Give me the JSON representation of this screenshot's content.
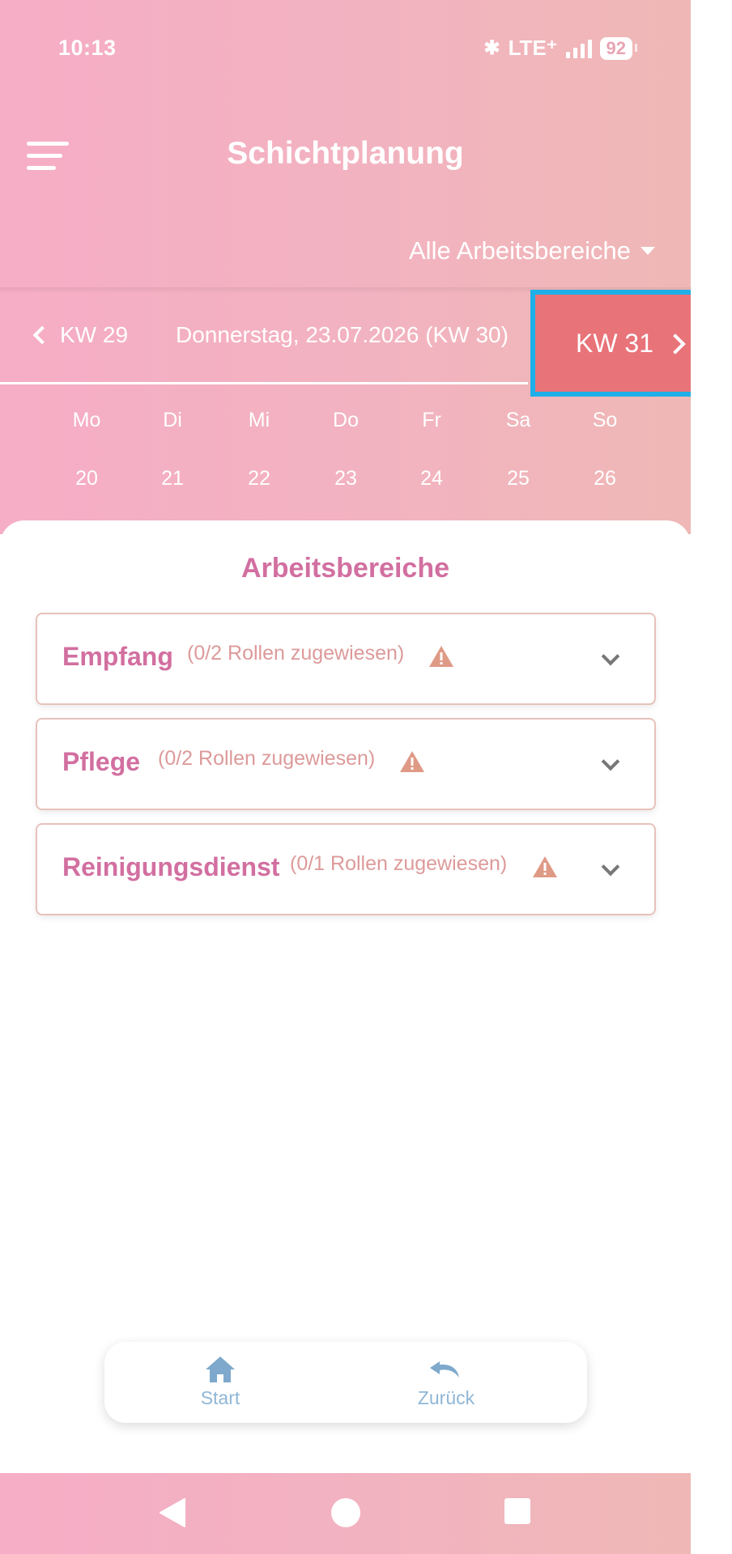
{
  "status_bar": {
    "time": "10:13",
    "bluetooth_icon": "bluetooth-icon",
    "network": "LTE⁺",
    "battery": "92"
  },
  "header": {
    "menu_icon": "hamburger-menu-icon",
    "title": "Schichtplanung",
    "area_filter": "Alle Arbeitsbereiche"
  },
  "week_nav": {
    "prev_label": "KW 29",
    "current_date": "Donnerstag, 23.07.2026 (KW 30)",
    "next_label": "KW 31"
  },
  "days": [
    {
      "name": "Mo",
      "date": "20"
    },
    {
      "name": "Di",
      "date": "21"
    },
    {
      "name": "Mi",
      "date": "22"
    },
    {
      "name": "Do",
      "date": "23"
    },
    {
      "name": "Fr",
      "date": "24"
    },
    {
      "name": "Sa",
      "date": "25"
    },
    {
      "name": "So",
      "date": "26"
    }
  ],
  "main": {
    "section_title": "Arbeitsbereiche",
    "areas": [
      {
        "name": "Empfang",
        "info": "(0/2 Rollen zugewiesen)"
      },
      {
        "name": "Pflege",
        "info": "(0/2 Rollen zugewiesen)"
      },
      {
        "name": "Reinigungsdienst",
        "info": "(0/1 Rollen zugewiesen)"
      }
    ]
  },
  "bottom_nav": {
    "start_label": "Start",
    "back_label": "Zurück"
  },
  "colors": {
    "accent_pink": "#d26fa0",
    "highlight_red": "#e87378",
    "selection_border": "#1eafe8",
    "warning": "#df9a86"
  }
}
